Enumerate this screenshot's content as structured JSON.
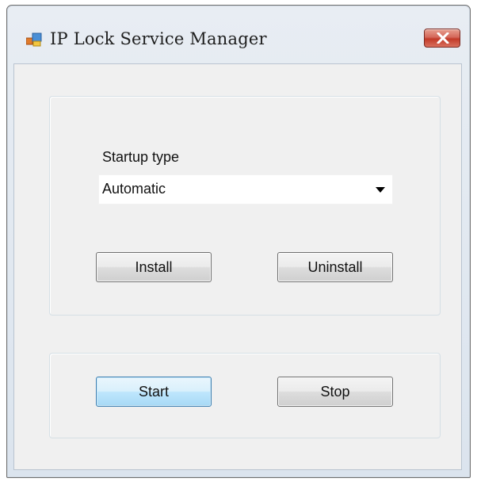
{
  "window": {
    "title": "IP Lock Service Manager",
    "icon": "app-window-icon",
    "close_icon": "close-icon",
    "close_color": "#c94a39"
  },
  "service": {
    "startup_type_label": "Startup type",
    "startup_type_value": "Automatic",
    "dropdown_icon": "chevron-down-icon",
    "install_label": "Install",
    "uninstall_label": "Uninstall",
    "start_label": "Start",
    "stop_label": "Stop",
    "focused_button_color": "#3c7fb1"
  }
}
